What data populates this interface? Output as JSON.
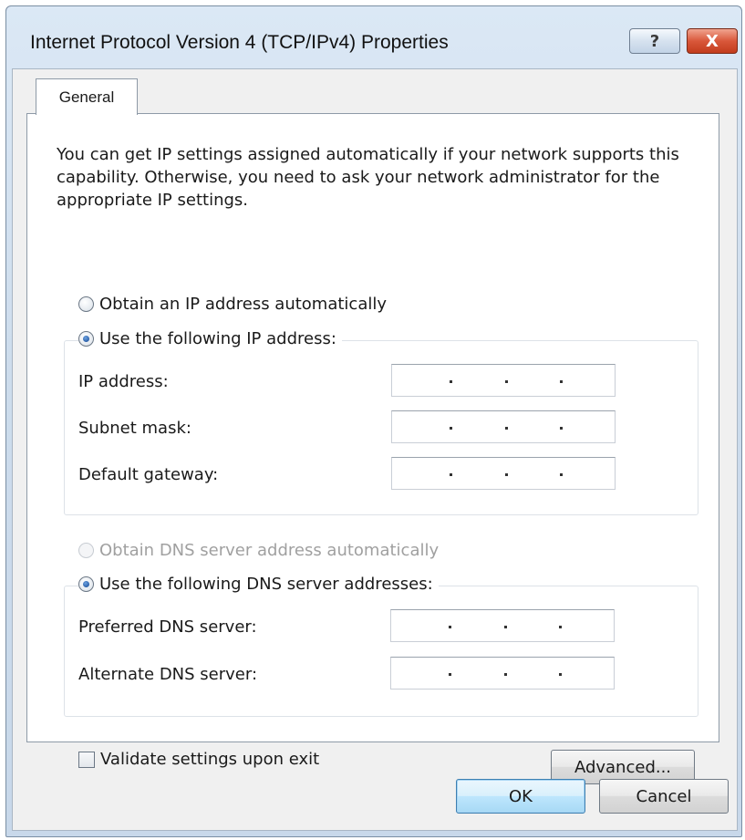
{
  "window": {
    "title": "Internet Protocol Version 4 (TCP/IPv4) Properties",
    "help_icon": "?",
    "close_icon": "X"
  },
  "tabs": [
    {
      "label": "General",
      "selected": true
    }
  ],
  "description": "You can get IP settings assigned automatically if your network supports this capability. Otherwise, you need to ask your network administrator for the appropriate IP settings.",
  "ip_section": {
    "auto_option": {
      "label": "Obtain an IP address automatically",
      "selected": false
    },
    "manual_option": {
      "label": "Use the following IP address:",
      "selected": true
    },
    "fields": [
      {
        "label": "IP address:",
        "value": ". . ."
      },
      {
        "label": "Subnet mask:",
        "value": ". . ."
      },
      {
        "label": "Default gateway:",
        "value": ". . ."
      }
    ]
  },
  "dns_section": {
    "auto_option": {
      "label": "Obtain DNS server address automatically",
      "selected": false,
      "disabled": true
    },
    "manual_option": {
      "label": "Use the following DNS server addresses:",
      "selected": true
    },
    "fields": [
      {
        "label": "Preferred DNS server:",
        "value": ". . ."
      },
      {
        "label": "Alternate DNS server:",
        "value": ". . ."
      }
    ]
  },
  "validate_checkbox": {
    "label": "Validate settings upon exit",
    "checked": false
  },
  "buttons": {
    "advanced": "Advanced...",
    "ok": "OK",
    "cancel": "Cancel"
  }
}
